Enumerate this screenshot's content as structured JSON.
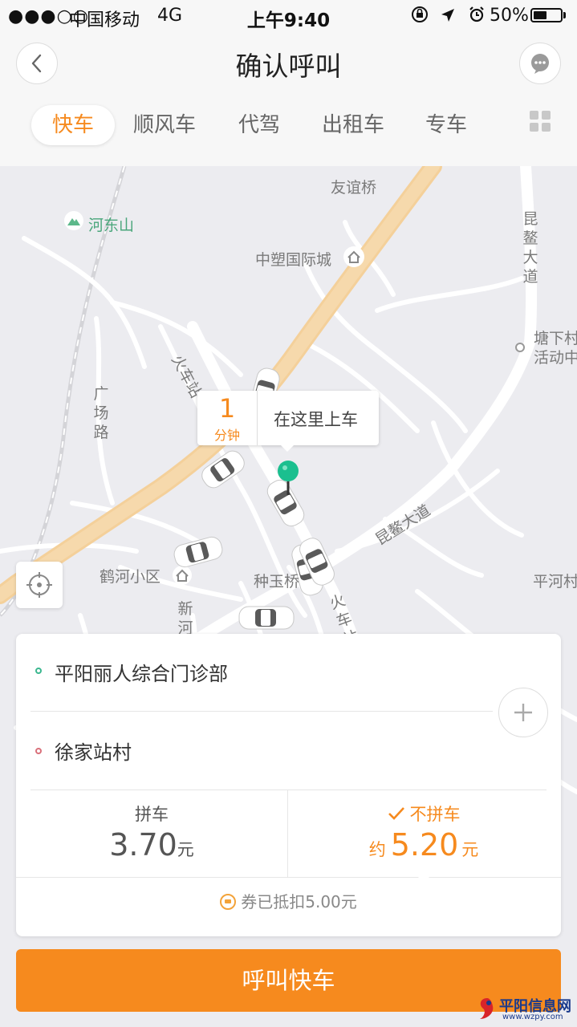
{
  "status_bar": {
    "signal": "●●●○○",
    "carrier": "中国移动",
    "network": "4G",
    "time": "上午9:40",
    "battery_percent": "50%",
    "battery_level": 0.5
  },
  "nav": {
    "title": "确认呼叫"
  },
  "tabs": [
    {
      "label": "快车",
      "active": true
    },
    {
      "label": "顺风车",
      "active": false
    },
    {
      "label": "代驾",
      "active": false
    },
    {
      "label": "出租车",
      "active": false
    },
    {
      "label": "专车",
      "active": false
    }
  ],
  "map": {
    "labels": {
      "youyi_bridge": "友谊桥",
      "hedong_mountain": "河东山",
      "zhongsu": "中塑国际城",
      "kunao_avenue_vertical": "昆鳌大道",
      "tangxia": "塘下村活动中",
      "guangchang_road": "广场路",
      "huochezhan_road_top": "火车站",
      "kunao_avenue": "昆鳌大道",
      "hehe_district": "鹤河小区",
      "zhongyu_bridge": "种玉桥",
      "pinghe_village": "平河村",
      "xinhe": "新河",
      "huochezhan_road_bottom": "火车站"
    },
    "pickup_callout": {
      "eta_number": "1",
      "eta_unit": "分钟",
      "text": "在这里上车"
    }
  },
  "trip": {
    "origin": "平阳丽人综合门诊部",
    "destination": "徐家站村",
    "options": [
      {
        "label": "拼车",
        "prefix": "",
        "price": "3.70",
        "unit": "元",
        "selected": false
      },
      {
        "label": "不拼车",
        "prefix": "约",
        "price": "5.20",
        "unit": "元",
        "selected": true
      }
    ],
    "coupon_text": "券已抵扣5.00元"
  },
  "call_button": "呼叫快车",
  "watermark": {
    "main": "平阳信息网",
    "sub": "www.wzpy.com"
  },
  "colors": {
    "accent": "#f68a1e",
    "origin_dot": "#3bb78f",
    "destination_dot": "#d9707a",
    "pin": "#1bbf8f"
  }
}
